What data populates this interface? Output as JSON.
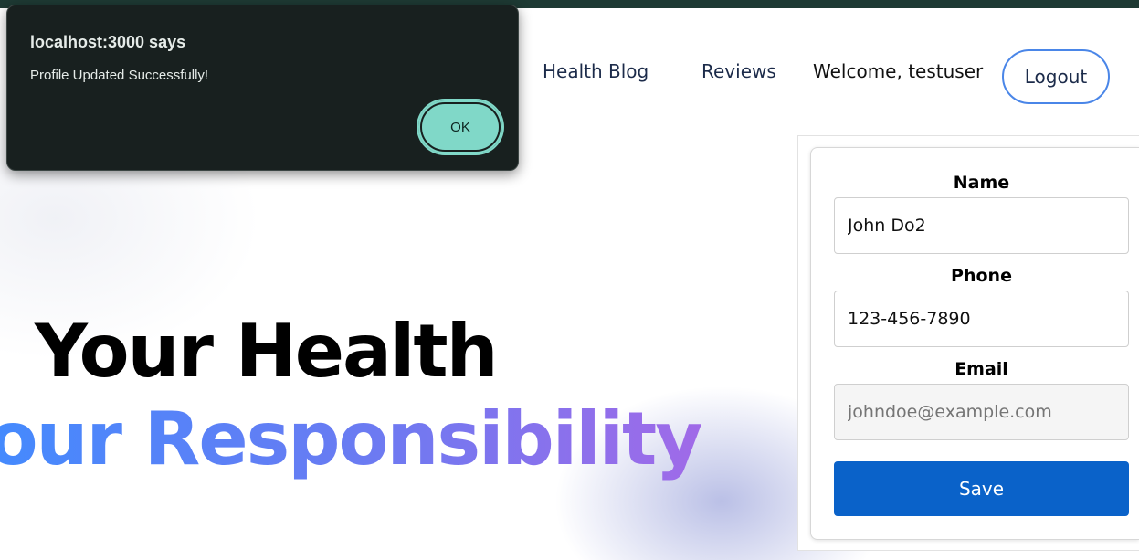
{
  "nav": {
    "items": [
      {
        "label": "Health Blog"
      },
      {
        "label": "Reviews"
      }
    ],
    "welcome": "Welcome, testuser",
    "logout_label": "Logout"
  },
  "hero": {
    "line1": "Your Health",
    "line2": "Your Responsibility"
  },
  "profile_form": {
    "name_label": "Name",
    "name_value": "John Do2",
    "phone_label": "Phone",
    "phone_value": "123-456-7890",
    "email_label": "Email",
    "email_placeholder": "johndoe@example.com",
    "save_label": "Save"
  },
  "alert_dialog": {
    "title": "localhost:3000 says",
    "message": "Profile Updated Successfully!",
    "ok_label": "OK"
  },
  "colors": {
    "accent": "#0a62c9",
    "dialog_bg": "#18201f",
    "ok_button": "#80d8c8",
    "gradient_start": "#3f8cff",
    "gradient_end": "#a06ae8"
  }
}
